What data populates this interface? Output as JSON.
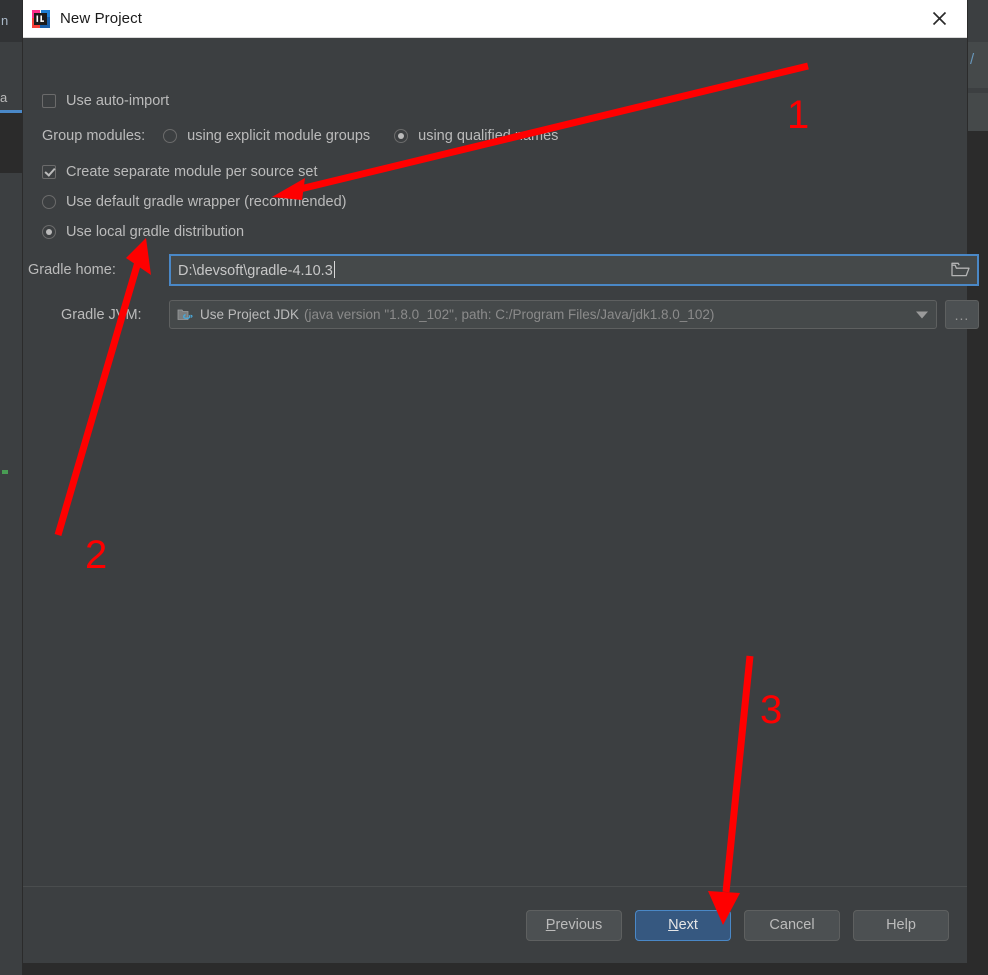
{
  "background": {
    "left_toolwindow_label": "n",
    "left_tab_label": "a",
    "right_glyph": "/"
  },
  "titlebar": {
    "app_icon": "intellij-idea-icon",
    "title": "New Project",
    "close_icon": "close-icon"
  },
  "form": {
    "auto_import": {
      "label": "Use auto-import",
      "checked": false
    },
    "group_modules": {
      "label": "Group modules:",
      "options": [
        {
          "label": "using explicit module groups",
          "selected": false
        },
        {
          "label": "using qualified names",
          "selected": true
        }
      ]
    },
    "separate_module": {
      "label": "Create separate module per source set",
      "checked": true
    },
    "gradle_distribution": {
      "options": [
        {
          "label": "Use default gradle wrapper (recommended)",
          "selected": false
        },
        {
          "label": "Use local gradle distribution",
          "selected": true
        }
      ]
    },
    "gradle_home": {
      "label": "Gradle home:",
      "value": "D:\\devsoft\\gradle-4.10.3",
      "browse_icon": "folder-icon"
    },
    "gradle_jvm": {
      "label": "Gradle JVM:",
      "icon": "jdk-icon",
      "value": "Use Project JDK",
      "detail": "(java version \"1.8.0_102\", path: C:/Program Files/Java/jdk1.8.0_102)",
      "dropdown_icon": "chevron-down-icon",
      "more_button_label": "..."
    }
  },
  "footer": {
    "buttons": [
      {
        "name": "previous",
        "mnemonic": "P",
        "rest": "revious",
        "primary": false
      },
      {
        "name": "next",
        "mnemonic": "N",
        "rest": "ext",
        "primary": true
      },
      {
        "name": "cancel",
        "mnemonic": "",
        "rest": "Cancel",
        "primary": false
      },
      {
        "name": "help",
        "mnemonic": "",
        "rest": "Help",
        "primary": false
      }
    ]
  },
  "annotations": {
    "color": "#ff0000",
    "items": [
      {
        "number": "1",
        "target": "Use local gradle distribution radio"
      },
      {
        "number": "2",
        "target": "Gradle home text field"
      },
      {
        "number": "3",
        "target": "Next button"
      }
    ]
  }
}
